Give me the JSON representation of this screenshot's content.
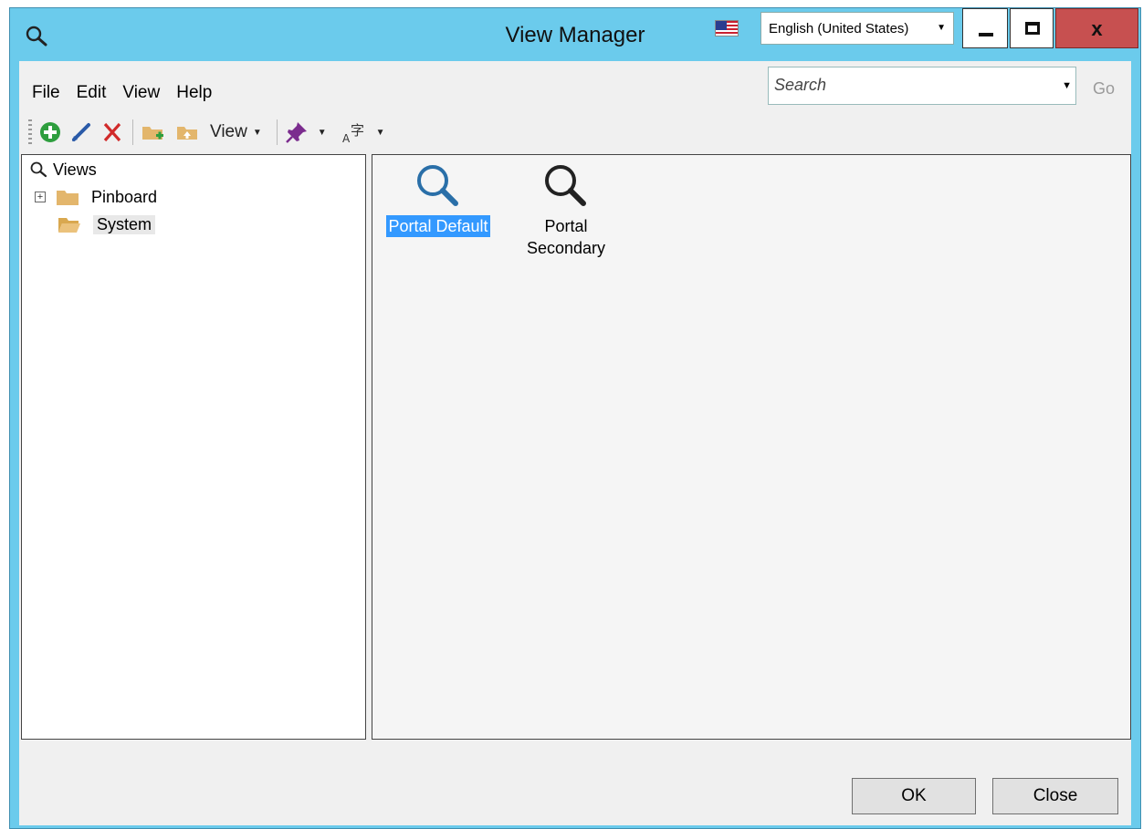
{
  "window": {
    "title": "View Manager",
    "language": "English (United States)",
    "close_glyph": "x"
  },
  "menu": {
    "file": "File",
    "edit": "Edit",
    "view": "View",
    "help": "Help"
  },
  "search": {
    "placeholder": "Search",
    "go_label": "Go"
  },
  "toolbar": {
    "view_label": "View",
    "icons": [
      "add-icon",
      "edit-icon",
      "delete-icon",
      "new-folder-icon",
      "folder-up-icon",
      "pin-icon",
      "font-icon"
    ]
  },
  "tree": {
    "root": "Views",
    "items": [
      {
        "label": "Pinboard",
        "expandable": true
      },
      {
        "label": "System",
        "expandable": false,
        "selected": true
      }
    ]
  },
  "content": {
    "items": [
      {
        "label": "Portal Default",
        "selected": true
      },
      {
        "label": "Portal Secondary",
        "selected": false
      }
    ]
  },
  "buttons": {
    "ok": "OK",
    "close": "Close"
  },
  "colors": {
    "titlebar": "#6bcbec",
    "close_button": "#c75050",
    "selection": "#3399ff",
    "add_icon": "#2e9e3e",
    "delete_icon": "#d12a2a",
    "folder": "#e3b66c"
  }
}
